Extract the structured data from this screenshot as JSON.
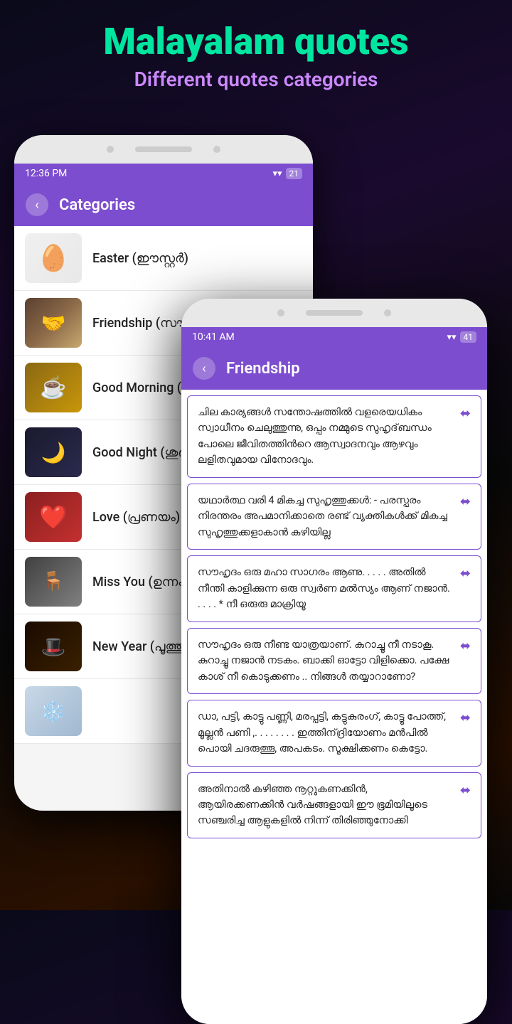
{
  "page": {
    "title": "Malayalam quotes",
    "subtitle": "Different quotes categories"
  },
  "phone_back": {
    "status_bar": {
      "time": "12:36 PM",
      "wifi_icon": "wifi",
      "battery": "21"
    },
    "app_bar": {
      "back_label": "‹",
      "title": "Categories"
    },
    "categories": [
      {
        "id": "easter",
        "label": "Easter (ഈസ്റ്റർ)",
        "thumb_type": "easter",
        "thumb_icon": "🥚"
      },
      {
        "id": "friendship",
        "label": "Friendship (സൗ...",
        "thumb_type": "friendship",
        "thumb_icon": "🤝"
      },
      {
        "id": "goodmorning",
        "label": "Good Morning (ഗ...",
        "thumb_type": "goodmorning",
        "thumb_icon": "☕"
      },
      {
        "id": "goodnight",
        "label": "Good Night (ശുഭ...",
        "thumb_type": "goodnight",
        "thumb_icon": "🌙"
      },
      {
        "id": "love",
        "label": "Love (പ്രണയം)",
        "thumb_type": "love",
        "thumb_icon": "❤️"
      },
      {
        "id": "missyou",
        "label": "Miss You (ഉന്നം...",
        "thumb_type": "missyou",
        "thumb_icon": "🪑"
      },
      {
        "id": "newyear",
        "label": "New Year (പൂത്തു...",
        "thumb_type": "newyear",
        "thumb_icon": "🎩"
      },
      {
        "id": "winter",
        "label": "...",
        "thumb_type": "winter",
        "thumb_icon": "❄️"
      }
    ]
  },
  "phone_front": {
    "status_bar": {
      "time": "10:41 AM",
      "wifi_icon": "wifi",
      "battery": "41"
    },
    "app_bar": {
      "back_label": "‹",
      "title": "Friendship"
    },
    "quotes": [
      {
        "id": 1,
        "text": "ചില കാര്യങ്ങൾ സന്തോഷത്തിൽ വളരെയധികം സ്വാധീനം ചെലുത്തുന്നു, ഒപ്പം നമ്മുടെ സുഹൃദ്‌ബന്ധം പോലെ ജീവിതത്തിന്‍റെ ആസ്വാദനവും ആഴവും ലളിതവുമായ വിനോദവും."
      },
      {
        "id": 2,
        "text": "യഥാർത്ഥ വരി 4 മികച്ച സുഹൃത്തുക്കൾ:\n- പരസ്പരം നിരന്തരം അപമാനിക്കാതെ രണ്ട് വ്യക്തികൾക്ക് മികച്ച സുഹൃത്തുക്കളാകാൻ കഴിയില്ല"
      },
      {
        "id": 3,
        "text": "സൗഹൃദം ഒരു മഹാ സാഗരം ആണു. . . . . അതിൽ നീന്തി കാളിക്കുന്ന ഒരു സ്വർണ മൽസ്യം ആണ്‌ നജാൻ. . . . . * നീ ഒരുരു മാക്രിയൂ"
      },
      {
        "id": 4,
        "text": "സൗഹൃദം ഒരു നീണ്ട യാത്രയാണ്. കുറാച്ചൂ നീ നടാകൂ. കുറാച്ചൂ നജാൻ നടകം. ബാക്കി ഓട്ടോ വിളിക്കൊ. പക്ഷേ കാശ്‌ നീ കൊടുക്കണം .. നിങ്ങൾ തയ്യാറാണോ?"
      },
      {
        "id": 5,
        "text": "ഡാ, പട്ടി, കാട്ടു പണ്ണി, മരപ്പട്ടി, കട്ടുകുരംഗ്, കാട്ടൂ പോത്ത്, മൂല്ലൻ പണി ,. . . . . . . . ഇത്തിന്‌ദ്രിയോണം മൻപിൽ പൊയി ചദരുത്തൂ, അപകടം. സൂക്ഷിക്കണം കെട്ടോ."
      },
      {
        "id": 6,
        "text": "അതിനാൽ കഴിഞ്ഞ നൂറ്റുകണക്കിൻ, ആയിരക്കണക്കിൻ വർഷങ്ങളായി ഈ ഭൂമിയിലൂടെ സഞ്ചരിച്ച ആളുകളിൽ നിന്ന് തിരിഞ്ഞുനോക്കി"
      }
    ]
  }
}
